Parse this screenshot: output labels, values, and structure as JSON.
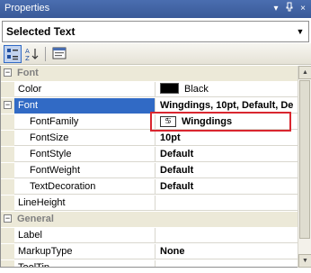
{
  "window": {
    "title": "Properties",
    "buttons": {
      "dropdown": "▾",
      "pin": "ᵖ",
      "close": "×"
    }
  },
  "object_selector": {
    "value": "Selected Text"
  },
  "toolbar": {
    "icons": [
      "categorized-icon",
      "alphabetical-icon",
      "property-pages-icon"
    ]
  },
  "grid": {
    "categories": {
      "font": "Font",
      "general": "General"
    },
    "rows": {
      "color": {
        "name": "Color",
        "value": "Black",
        "swatch": "#000000"
      },
      "font": {
        "name": "Font",
        "value": "Wingdings, 10pt, Default, De"
      },
      "fontfamily": {
        "name": "FontFamily",
        "value": "Wingdings",
        "icon_glyph": "♋"
      },
      "fontsize": {
        "name": "FontSize",
        "value": "10pt"
      },
      "fontstyle": {
        "name": "FontStyle",
        "value": "Default"
      },
      "fontweight": {
        "name": "FontWeight",
        "value": "Default"
      },
      "textdecoration": {
        "name": "TextDecoration",
        "value": "Default"
      },
      "lineheight": {
        "name": "LineHeight",
        "value": ""
      },
      "label": {
        "name": "Label",
        "value": ""
      },
      "markuptype": {
        "name": "MarkupType",
        "value": "None"
      },
      "tooltip": {
        "name": "ToolTip",
        "value": ""
      }
    }
  },
  "colors": {
    "accent": "#316ac5",
    "highlight_border": "#d9262f",
    "title_bar": "#3a5a98"
  }
}
